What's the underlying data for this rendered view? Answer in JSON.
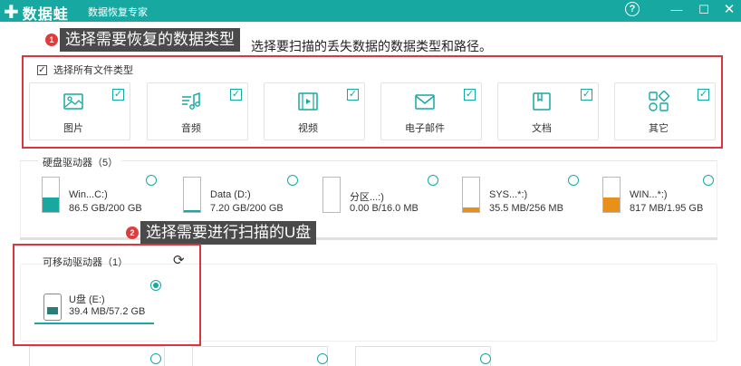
{
  "app": {
    "logo_text": "数据蛙",
    "title": "数据恢复专家",
    "help": "?",
    "minimize": "—",
    "maximize": "☐",
    "close": "✕"
  },
  "callouts": [
    {
      "num": "1",
      "text": "选择需要恢复的数据类型"
    },
    {
      "num": "2",
      "text": "选择需要进行扫描的U盘"
    }
  ],
  "subtitle": "选择要扫描的丢失数据的数据类型和路径。",
  "file_types": {
    "select_all_label": "选择所有文件类型",
    "select_all_checked": true,
    "items": [
      {
        "label": "图片",
        "icon": "image-icon",
        "checked": true
      },
      {
        "label": "音频",
        "icon": "audio-icon",
        "checked": true
      },
      {
        "label": "视频",
        "icon": "video-icon",
        "checked": true
      },
      {
        "label": "电子邮件",
        "icon": "email-icon",
        "checked": true
      },
      {
        "label": "文档",
        "icon": "document-icon",
        "checked": true
      },
      {
        "label": "其它",
        "icon": "other-icon",
        "checked": true
      }
    ]
  },
  "hard_drives": {
    "title": "硬盘驱动器（5）",
    "items": [
      {
        "name": "Win...C:)",
        "size": "86.5 GB/200 GB",
        "used_fraction": 0.43,
        "color": "#17a9a1"
      },
      {
        "name": "Data (D:)",
        "size": "7.20 GB/200 GB",
        "used_fraction": 0.04,
        "color": "#17a9a1"
      },
      {
        "name": "分区...:)",
        "size": "0.00  B/16.0 MB",
        "used_fraction": 0.0,
        "color": "#17a9a1"
      },
      {
        "name": "SYS...*:)",
        "size": "35.5 MB/256 MB",
        "used_fraction": 0.14,
        "color": "#e8901a"
      },
      {
        "name": "WIN...*:)",
        "size": "817 MB/1.95 GB",
        "used_fraction": 0.42,
        "color": "#e8901a"
      }
    ]
  },
  "removable": {
    "title": "可移动驱动器（1）",
    "refresh": "⟳",
    "items": [
      {
        "name": "U盘 (E:)",
        "size": "39.4 MB/57.2 GB",
        "selected": true
      }
    ]
  },
  "colors": {
    "accent": "#17a9a1",
    "highlight_box": "#d9363e",
    "warning_fill": "#e8901a"
  }
}
